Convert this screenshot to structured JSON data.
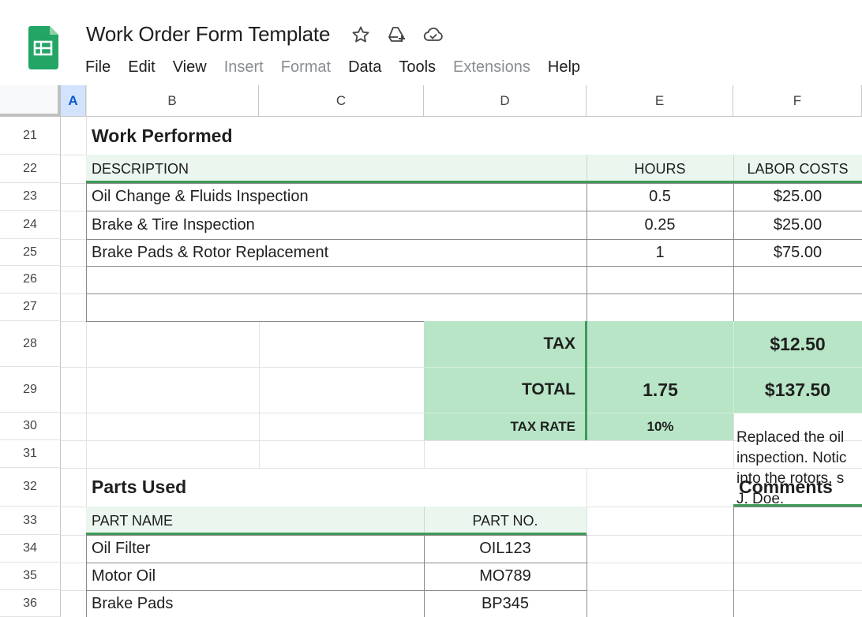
{
  "app": {
    "doc_title": "Work Order Form Template",
    "menu": [
      "File",
      "Edit",
      "View",
      "Insert",
      "Format",
      "Data",
      "Tools",
      "Extensions",
      "Help"
    ],
    "menu_dimmed": [
      "Insert",
      "Format",
      "Extensions"
    ],
    "icons": [
      "sheets-logo-icon",
      "star-icon",
      "drive-move-icon",
      "cloud-saved-icon"
    ],
    "accent_color": "#3d9a58",
    "fill_light": "#eaf6ee",
    "fill_green": "#b7e5c6"
  },
  "grid": {
    "columns": [
      "A",
      "B",
      "C",
      "D",
      "E",
      "F"
    ],
    "selected_column": "A",
    "rows": [
      "21",
      "22",
      "23",
      "24",
      "25",
      "26",
      "27",
      "28",
      "29",
      "30",
      "31",
      "32",
      "33",
      "34",
      "35",
      "36"
    ]
  },
  "work_performed": {
    "title": "Work Performed",
    "headers": {
      "description": "DESCRIPTION",
      "hours": "HOURS",
      "labor": "LABOR COSTS"
    },
    "items": [
      {
        "description": "Oil Change & Fluids Inspection",
        "hours": "0.5",
        "labor": "$25.00"
      },
      {
        "description": "Brake & Tire Inspection",
        "hours": "0.25",
        "labor": "$25.00"
      },
      {
        "description": "Brake Pads & Rotor Replacement",
        "hours": "1",
        "labor": "$75.00"
      },
      {
        "description": "",
        "hours": "",
        "labor": ""
      },
      {
        "description": "",
        "hours": "",
        "labor": ""
      }
    ],
    "summary": {
      "tax_label": "TAX",
      "tax_value": "$12.50",
      "total_label": "TOTAL",
      "total_hours": "1.75",
      "total_value": "$137.50",
      "tax_rate_label": "TAX RATE",
      "tax_rate_value": "10%"
    }
  },
  "parts_used": {
    "title": "Parts Used",
    "headers": {
      "name": "PART NAME",
      "number": "PART NO."
    },
    "items": [
      {
        "name": "Oil Filter",
        "number": "OIL123"
      },
      {
        "name": "Motor Oil",
        "number": "MO789"
      },
      {
        "name": "Brake Pads",
        "number": "BP345"
      }
    ]
  },
  "comments": {
    "title": "Comments",
    "text": "Replaced the oil\ninspection. Notic\ninto the rotors, s\nJ. Doe."
  }
}
